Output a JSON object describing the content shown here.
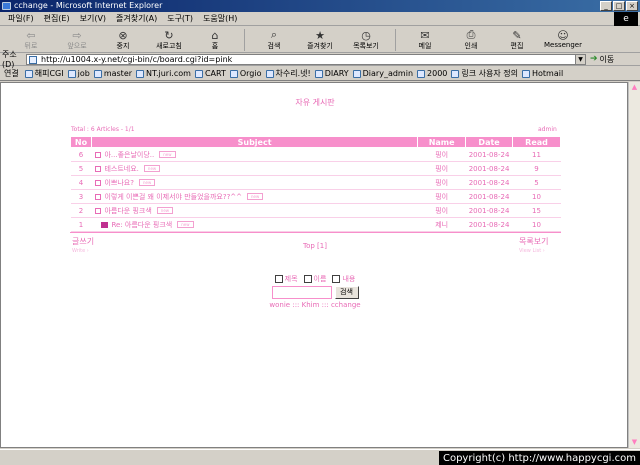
{
  "window": {
    "title": "cchange - Microsoft Internet Explorer",
    "buttons": [
      "_",
      "□",
      "×"
    ]
  },
  "menu": [
    "파일(F)",
    "편집(E)",
    "보기(V)",
    "즐겨찾기(A)",
    "도구(T)",
    "도움말(H)"
  ],
  "throbber": "e",
  "toolbar": [
    {
      "label": "뒤로",
      "icon": "back-arrow-icon",
      "glyph": "⇦",
      "disabled": true
    },
    {
      "label": "앞으로",
      "icon": "forward-arrow-icon",
      "glyph": "⇨",
      "disabled": true
    },
    {
      "label": "중지",
      "icon": "stop-icon",
      "glyph": "⊗",
      "disabled": false
    },
    {
      "label": "새로고침",
      "icon": "refresh-icon",
      "glyph": "↻",
      "disabled": false
    },
    {
      "label": "홈",
      "icon": "home-icon",
      "glyph": "⌂",
      "disabled": false
    },
    {
      "label": "검색",
      "icon": "search-icon",
      "glyph": "⌕",
      "disabled": false
    },
    {
      "label": "즐겨찾기",
      "icon": "favorites-icon",
      "glyph": "★",
      "disabled": false
    },
    {
      "label": "목록보기",
      "icon": "history-icon",
      "glyph": "◷",
      "disabled": false
    },
    {
      "label": "메일",
      "icon": "mail-icon",
      "glyph": "✉",
      "disabled": false
    },
    {
      "label": "인쇄",
      "icon": "print-icon",
      "glyph": "⎙",
      "disabled": false
    },
    {
      "label": "편집",
      "icon": "edit-icon",
      "glyph": "✎",
      "disabled": false
    },
    {
      "label": "Messenger",
      "icon": "messenger-icon",
      "glyph": "☺",
      "disabled": false
    }
  ],
  "address": {
    "label": "주소(D)",
    "url": "http://u1004.x-y.net/cgi-bin/c/board.cgi?id=pink",
    "go_label": "이동",
    "dropdown": "▼"
  },
  "links": {
    "label": "연결",
    "items": [
      "해피CGI",
      "job",
      "master",
      "NT.juri.com",
      "CART",
      "Orgio",
      "차수리.넷!",
      "DIARY",
      "Diary_admin",
      "2000",
      "링크 사용자 정의",
      "Hotmail"
    ]
  },
  "scroll": {
    "up": "▲",
    "down": "▼"
  },
  "board": {
    "title": "자유 게시판",
    "total": "Total : 6 Articles - 1/1",
    "admin": "admin",
    "columns": [
      "No",
      "Subject",
      "Name",
      "Date",
      "Read"
    ],
    "rows": [
      {
        "no": "6",
        "subject": "아...좋은날이당..",
        "badge": "new",
        "reply": false,
        "name": "핑이",
        "date": "2001-08-24",
        "read": "11"
      },
      {
        "no": "5",
        "subject": "테스트네요.",
        "badge": "new",
        "reply": false,
        "name": "핑이",
        "date": "2001-08-24",
        "read": "9"
      },
      {
        "no": "4",
        "subject": "이쁘나요?",
        "badge": "new",
        "reply": false,
        "name": "핑이",
        "date": "2001-08-24",
        "read": "5"
      },
      {
        "no": "3",
        "subject": "이렇게 이쁜걸 왜 이제서야 만들었을까요??^^",
        "badge": "new",
        "reply": false,
        "name": "핑이",
        "date": "2001-08-24",
        "read": "10"
      },
      {
        "no": "2",
        "subject": "아름다운 핑크색",
        "badge": "new",
        "reply": false,
        "name": "핑이",
        "date": "2001-08-24",
        "read": "15"
      },
      {
        "no": "1",
        "subject": "Re: 아름다운 핑크색",
        "badge": "new",
        "reply": true,
        "name": "제니",
        "date": "2001-08-24",
        "read": "10"
      }
    ],
    "write": "글쓰기",
    "write_sub": "Write ›",
    "paging": "Top  [1]",
    "list": "목록보기",
    "list_sub": "View List ›",
    "search": {
      "options": [
        "제목",
        "이름",
        "내용"
      ],
      "button": "검색",
      "input_value": ""
    },
    "credits": "wonie ::: Khim ::: cchange"
  },
  "status": {
    "copyright": "Copyright(c) http://www.happycgi.com"
  },
  "colors": {
    "accent": "#f78fcb",
    "text_pink": "#e86bb6"
  }
}
